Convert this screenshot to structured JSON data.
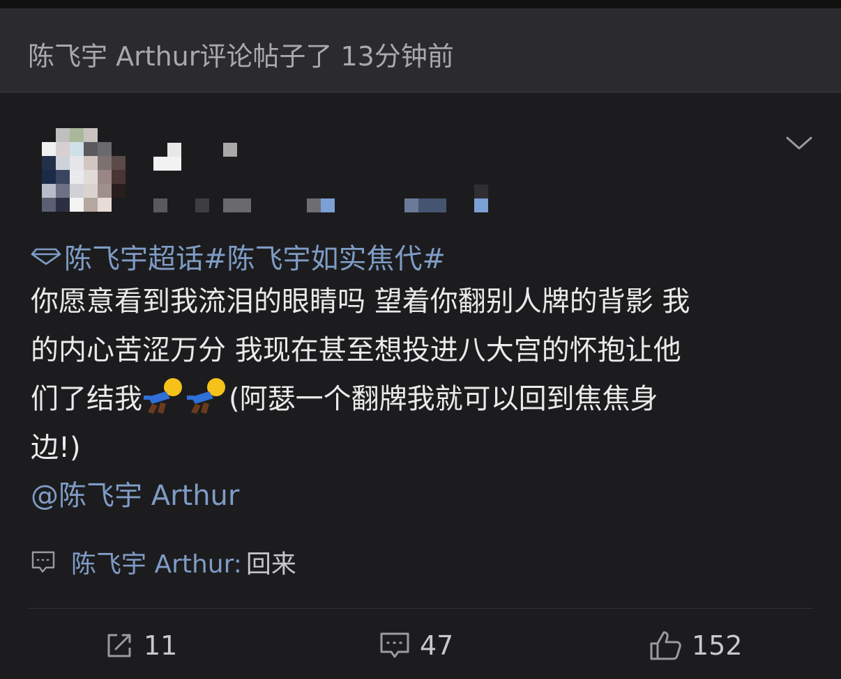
{
  "header": {
    "text": "陈飞宇 Arthur评论帖子了 13分钟前"
  },
  "post": {
    "topic_tag": "陈飞宇超话#陈飞宇如实焦代#",
    "body_lines": [
      "你愿意看到我流泪的眼睛吗 望着你翻别人牌的背影 我",
      "的内心苦涩万分 我现在甚至想投进八大宫的怀抱让他",
      "们了结我",
      "(阿瑟一个翻牌我就可以回到焦焦身",
      "边!)"
    ],
    "mention": "@陈飞宇 Arthur"
  },
  "reply": {
    "author": "陈飞宇 Arthur:",
    "text": "回来"
  },
  "actions": {
    "repost_count": "11",
    "comment_count": "47",
    "like_count": "152"
  },
  "colors": {
    "background": "#1c1c1e",
    "header_bg": "#2b2b2d",
    "link_blue": "#7f9cc6",
    "text": "#eaeaea",
    "muted": "#a9a9ad"
  },
  "icons": {
    "topic": "diamond-icon",
    "emoji": "kneeling-emoji-icon",
    "reply": "comment-icon",
    "more": "chevron-down-icon",
    "repost": "repost-icon",
    "comment": "comment-icon",
    "like": "thumbs-up-icon"
  }
}
